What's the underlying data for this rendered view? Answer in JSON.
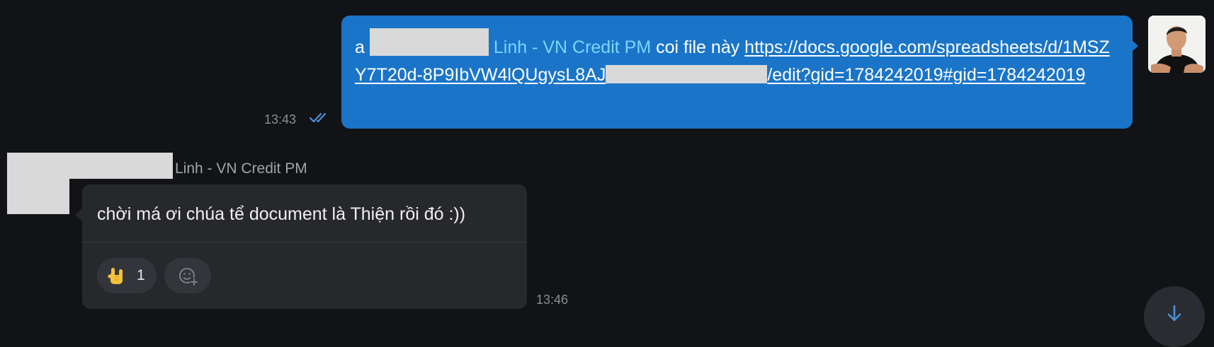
{
  "outgoing_message": {
    "prefix": "a ",
    "mention": "Linh - VN Credit PM",
    "text_before_link": " coi file này ",
    "link_part1": "https://docs.google.com/spreadsheets/d/1MSZY7T20d-8P9IbVW4lQUgysL8AJ",
    "link_part2": "/edit?gid=1784242019#gid=1784242019",
    "time": "13:43",
    "status_icon": "double-check-icon",
    "status_color": "#4a90d9"
  },
  "incoming_message": {
    "sender_name": "Linh - VN Credit PM",
    "text": "chời má ơi chúa tể document là Thiện rồi đó :))",
    "reactions": [
      {
        "emoji": "rock-on-hand-icon",
        "count": "1"
      }
    ],
    "add_reaction_icon": "add-reaction-icon",
    "time": "13:46"
  },
  "colors": {
    "background": "#121317",
    "outgoing_bubble": "#1a75c8",
    "incoming_bubble": "#27282c",
    "mention": "#7fd3ff"
  },
  "scroll_to_bottom_icon": "arrow-down-icon"
}
